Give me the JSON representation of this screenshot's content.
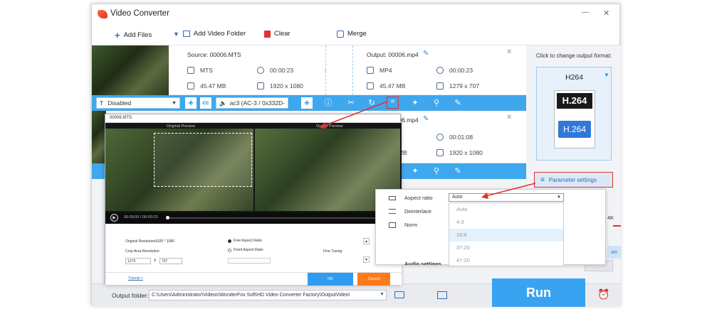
{
  "window": {
    "title": "Video Converter",
    "min": "—",
    "close": "✕"
  },
  "toolbar": {
    "add_files": "Add Files",
    "add_video_folder": "Add Video Folder",
    "clear": "Clear",
    "merge": "Merge"
  },
  "item1": {
    "source": "Source: 00006.MTS",
    "src_format": "MTS",
    "src_duration": "00:00:23",
    "src_size": "45.47 MB",
    "src_resolution": "1920 x 1080",
    "output": "Output: 00006.mp4",
    "out_format": "MP4",
    "out_duration": "00:00:23",
    "out_size": "45.47 MB",
    "out_resolution": "1279 x 707"
  },
  "editbar": {
    "subtitle": "Disabled",
    "audio": "ac3 (AC-3 / 0x332D-"
  },
  "item2": {
    "output": "Output: 00006.mp4",
    "out_duration": "00:01:08",
    "out_size_partial": "MB",
    "out_resolution": "1920 x 1080"
  },
  "format_panel": {
    "prompt": "Click to change output format:",
    "format": "H264",
    "logo_top": "H.264",
    "logo_bottom": "H.264",
    "param_settings": "Parameter settings",
    "side_label": "4K",
    "side_button": "on"
  },
  "crop_dialog": {
    "title": "00006.MTS",
    "orig_preview": "Original Preview",
    "out_preview": "Output Preview",
    "time": "00:00:00 / 00:00:23",
    "orig_res_label": "Original Resolution:",
    "orig_res": "1920 * 1080",
    "crop_label": "Crop Area Resolution:",
    "crop_w": "1279",
    "crop_x": "X",
    "crop_h": "707",
    "free_aspect": "Free Aspect Ratio",
    "fixed_aspect": "Fixed Aspect Ratio",
    "fine_tuning": "Fine Tuning:",
    "tutorial": "Tutorial >",
    "ok": "OK",
    "cancel": "Cancel"
  },
  "param_box": {
    "aspect_label": "Aspect ratio",
    "aspect_value": "Auto",
    "deinterlace_label": "Deinterlace",
    "norm_label": "Norm",
    "options": [
      "Auto",
      "4:3",
      "16:9",
      "37:20",
      "47:20"
    ],
    "audio_settings": "Audio settings"
  },
  "bottom": {
    "label": "Output folder:",
    "path": "C:\\Users\\Administrator\\Videos\\WonderFox Soft\\HD Video Converter Factory\\OutputVideo\\",
    "run": "Run"
  },
  "colors": {
    "accent": "#3fa7ee",
    "red": "#e03030",
    "cancel": "#ff7a1a"
  }
}
